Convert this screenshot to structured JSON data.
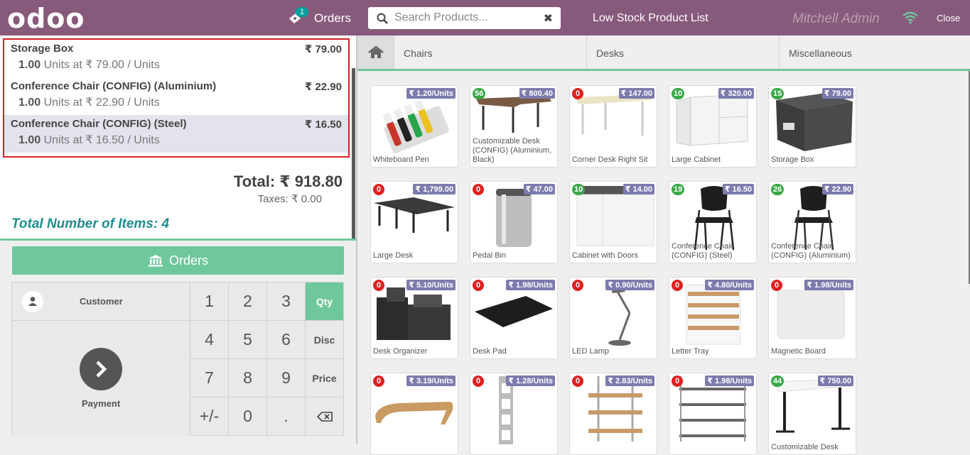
{
  "topbar": {
    "logo": "odoo",
    "orders_label": "Orders",
    "orders_count": "1",
    "search_placeholder": "Search Products...",
    "low_stock_label": "Low Stock Product List",
    "user": "Mitchell Admin",
    "close_label": "Close"
  },
  "order": {
    "lines": [
      {
        "name": "Storage Box",
        "price": "₹ 79.00",
        "qty": "1.00",
        "info": " Units at ₹ 79.00 / Units"
      },
      {
        "name": "Conference Chair (CONFIG) (Aluminium)",
        "price": "₹ 22.90",
        "qty": "1.00",
        "info": " Units at ₹ 22.90 / Units"
      },
      {
        "name": "Conference Chair (CONFIG) (Steel)",
        "price": "₹ 16.50",
        "qty": "1.00",
        "info": " Units at ₹ 16.50 / Units"
      }
    ],
    "total": "Total: ₹ 918.80",
    "taxes": "Taxes: ₹ 0.00",
    "total_items": "Total Number of Items: 4"
  },
  "control": {
    "orders_button": "Orders",
    "customer_label": "Customer",
    "payment_label": "Payment",
    "keys": [
      "1",
      "2",
      "3",
      "4",
      "5",
      "6",
      "7",
      "8",
      "9",
      "+/-",
      "0",
      "."
    ],
    "modes": [
      "Qty",
      "Disc",
      "Price"
    ],
    "active_mode": "Qty"
  },
  "categories": [
    "Chairs",
    "Desks",
    "Miscellaneous"
  ],
  "products": [
    {
      "name": "Whiteboard Pen",
      "price": "₹ 1.20/Units",
      "qty": ""
    },
    {
      "name": "Customizable Desk (CONFIG) (Aluminium, Black)",
      "price": "₹ 800.40",
      "qty": "56"
    },
    {
      "name": "Corner Desk Right Sit",
      "price": "₹ 147.00",
      "qty": "0"
    },
    {
      "name": "Large Cabinet",
      "price": "₹ 320.00",
      "qty": "10"
    },
    {
      "name": "Storage Box",
      "price": "₹ 79.00",
      "qty": "15"
    },
    {
      "name": "Large Desk",
      "price": "₹ 1,799.00",
      "qty": "0"
    },
    {
      "name": "Pedal Bin",
      "price": "₹ 47.00",
      "qty": "0"
    },
    {
      "name": "Cabinet with Doors",
      "price": "₹ 14.00",
      "qty": "10"
    },
    {
      "name": "Conference Chair (CONFIG) (Steel)",
      "price": "₹ 16.50",
      "qty": "19"
    },
    {
      "name": "Conference Chair (CONFIG) (Aluminium)",
      "price": "₹ 22.90",
      "qty": "26"
    },
    {
      "name": "Desk Organizer",
      "price": "₹ 5.10/Units",
      "qty": "0"
    },
    {
      "name": "Desk Pad",
      "price": "₹ 1.98/Units",
      "qty": "0"
    },
    {
      "name": "LED Lamp",
      "price": "₹ 0.90/Units",
      "qty": "0"
    },
    {
      "name": "Letter Tray",
      "price": "₹ 4.80/Units",
      "qty": "0"
    },
    {
      "name": "Magnetic Board",
      "price": "₹ 1.98/Units",
      "qty": "0"
    },
    {
      "name": "",
      "price": "₹ 3.19/Units",
      "qty": "0"
    },
    {
      "name": "",
      "price": "₹ 1.28/Units",
      "qty": "0"
    },
    {
      "name": "",
      "price": "₹ 2.83/Units",
      "qty": "0"
    },
    {
      "name": "",
      "price": "₹ 1.98/Units",
      "qty": "0"
    },
    {
      "name": "Customizable Desk",
      "price": "₹ 750.00",
      "qty": "44"
    }
  ],
  "colors": {
    "brand": "#875a7b",
    "accent": "#6ec89b",
    "price_tag": "#7c7bad",
    "selection": "#d51f25"
  }
}
